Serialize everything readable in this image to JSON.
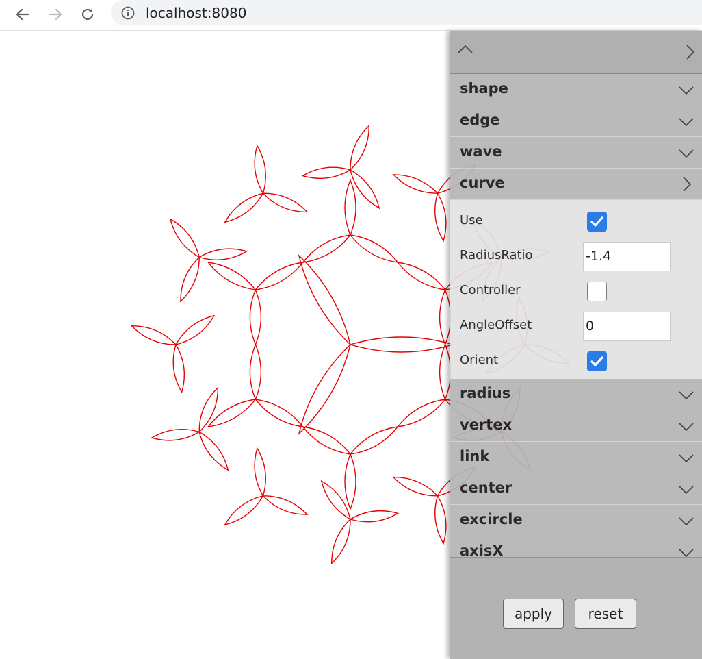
{
  "browser": {
    "url": "localhost:8080",
    "back_icon": "arrow-left-icon",
    "forward_icon": "arrow-right-icon",
    "reload_icon": "reload-icon",
    "info_icon": "info-icon"
  },
  "pattern": {
    "stroke_color": "#e60000"
  },
  "panel": {
    "collapse_icon": "chevron-up-icon",
    "close_icon": "chevron-right-icon",
    "sections": [
      {
        "title": "shape",
        "state": "collapsed"
      },
      {
        "title": "edge",
        "state": "collapsed"
      },
      {
        "title": "wave",
        "state": "collapsed"
      },
      {
        "title": "curve",
        "state": "expanded"
      },
      {
        "title": "radius",
        "state": "collapsed"
      },
      {
        "title": "vertex",
        "state": "collapsed"
      },
      {
        "title": "link",
        "state": "collapsed"
      },
      {
        "title": "center",
        "state": "collapsed"
      },
      {
        "title": "excircle",
        "state": "collapsed"
      },
      {
        "title": "axisX",
        "state": "collapsed"
      }
    ],
    "curve_fields": [
      {
        "label": "Use",
        "type": "checkbox",
        "checked": true
      },
      {
        "label": "RadiusRatio",
        "type": "number",
        "value": "-1.4"
      },
      {
        "label": "Controller",
        "type": "checkbox",
        "checked": false
      },
      {
        "label": "AngleOffset",
        "type": "number",
        "value": "0"
      },
      {
        "label": "Orient",
        "type": "checkbox",
        "checked": true
      }
    ],
    "apply_label": "apply",
    "reset_label": "reset"
  }
}
